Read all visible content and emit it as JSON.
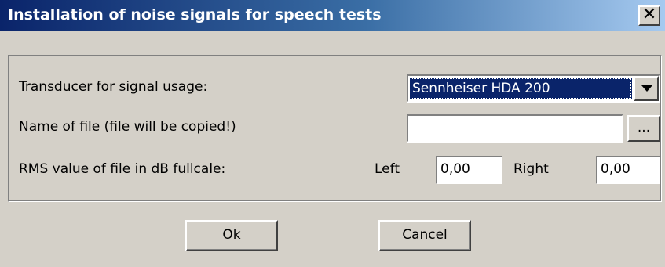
{
  "window": {
    "title": "Installation of noise signals for speech tests",
    "close_glyph": "✕"
  },
  "form": {
    "transducer_label": "Transducer for signal usage:",
    "transducer_value": "Sennheiser HDA 200",
    "file_label": "Name of file (file will be copied!)",
    "file_value": "",
    "browse_label": "...",
    "rms_label": "RMS value of file in dB fullcale:",
    "left_label": "Left",
    "left_value": "0,00",
    "right_label": "Right",
    "right_value": "0,00"
  },
  "buttons": {
    "ok_mnemonic": "O",
    "ok_rest": "k",
    "cancel_mnemonic": "C",
    "cancel_rest": "ancel"
  }
}
